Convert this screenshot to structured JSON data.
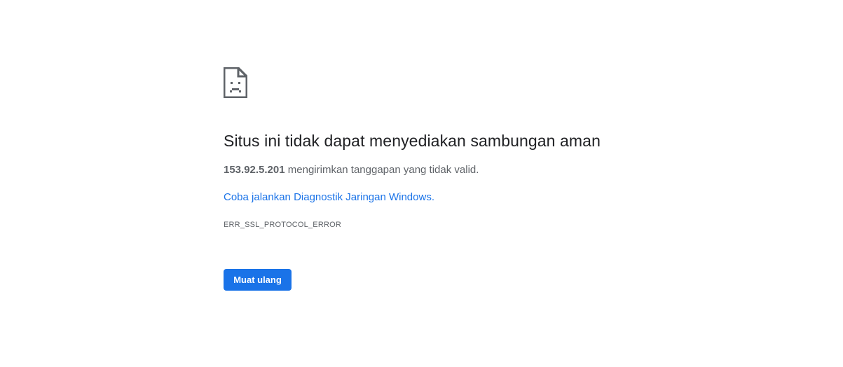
{
  "error_page": {
    "icon": "sad-document-icon",
    "title": "Situs ini tidak dapat menyediakan sambungan aman",
    "summary": {
      "host": "153.92.5.201",
      "message": " mengirimkan tanggapan yang tidak valid."
    },
    "diagnostics_link": "Coba jalankan Diagnostik Jaringan Windows.",
    "error_code": "ERR_SSL_PROTOCOL_ERROR",
    "reload_button": "Muat ulang"
  },
  "colors": {
    "background": "#ffffff",
    "title_text": "#202124",
    "secondary_text": "#5f6368",
    "link": "#1a73e8",
    "button_bg": "#1a73e8",
    "button_text": "#ffffff"
  }
}
